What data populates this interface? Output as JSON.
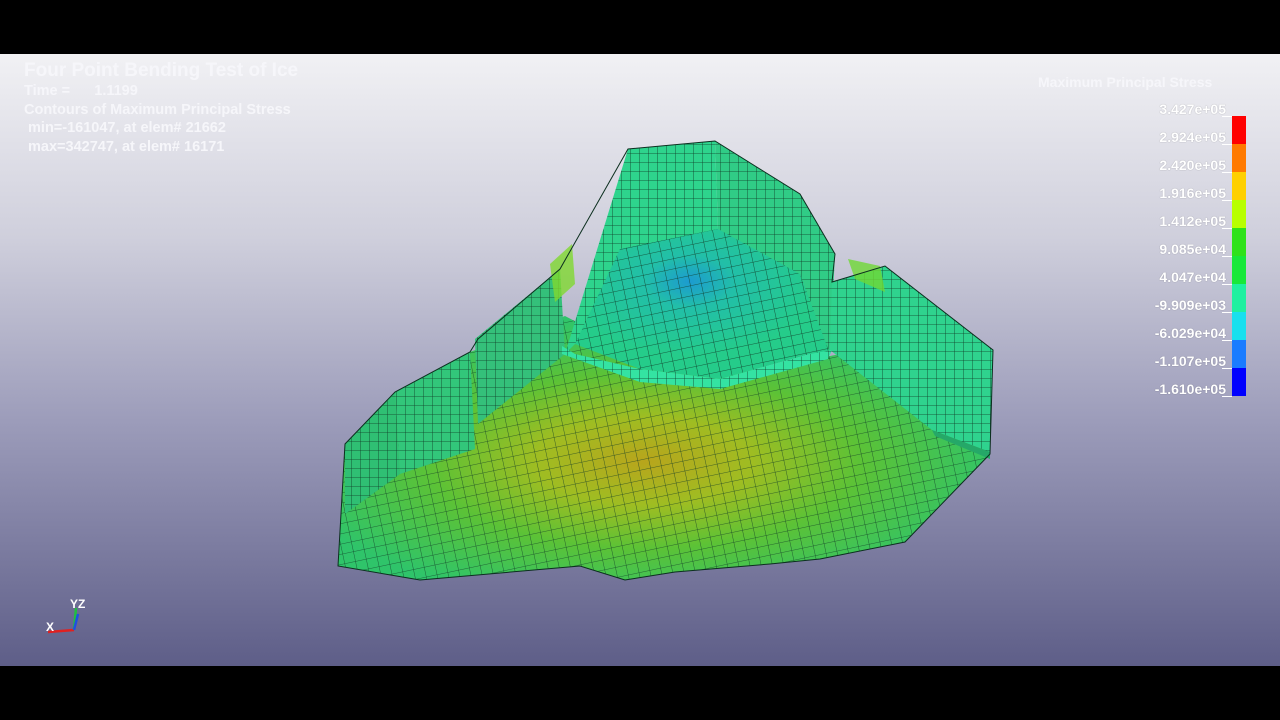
{
  "info": {
    "title": "Four Point Bending Test of Ice",
    "time_label": "Time =",
    "time_value": "1.1199",
    "contours": "Contours of Maximum Principal Stress",
    "min_line": " min=-161047, at elem# 21662",
    "max_line": " max=342747, at elem# 16171"
  },
  "legend": {
    "title": "Maximum Principal Stress",
    "labels": [
      "3.427e+05",
      "2.924e+05",
      "2.420e+05",
      "1.916e+05",
      "1.412e+05",
      "9.085e+04",
      "4.047e+04",
      "-9.909e+03",
      "-6.029e+04",
      "-1.107e+05",
      "-1.610e+05"
    ],
    "colors": [
      "#ff0000",
      "#ff7a00",
      "#ffd000",
      "#b8ff00",
      "#2fe21a",
      "#18e83a",
      "#1ff0a0",
      "#18e0ee",
      "#1a7cff",
      "#0000ff"
    ]
  },
  "axes": {
    "x_label": "X",
    "y_label": "Y",
    "z_label": "Z"
  }
}
